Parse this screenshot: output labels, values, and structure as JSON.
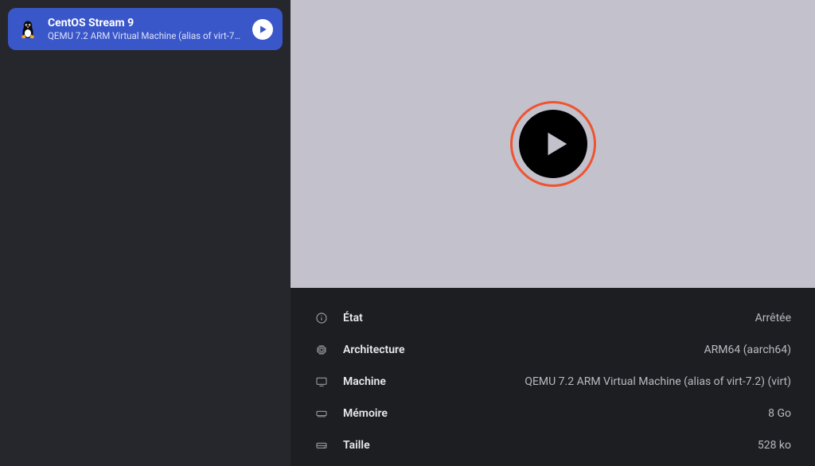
{
  "sidebar": {
    "vm": {
      "title": "CentOS Stream 9",
      "subtitle": "QEMU 7.2 ARM Virtual Machine (alias of virt-7.2)..."
    }
  },
  "details": {
    "rows": [
      {
        "icon": "info",
        "label": "État",
        "value": "Arrêtée"
      },
      {
        "icon": "chip",
        "label": "Architecture",
        "value": "ARM64 (aarch64)"
      },
      {
        "icon": "monitor",
        "label": "Machine",
        "value": "QEMU 7.2 ARM Virtual Machine (alias of virt-7.2) (virt)"
      },
      {
        "icon": "memory",
        "label": "Mémoire",
        "value": "8 Go"
      },
      {
        "icon": "disk",
        "label": "Taille",
        "value": "528 ko"
      }
    ]
  }
}
